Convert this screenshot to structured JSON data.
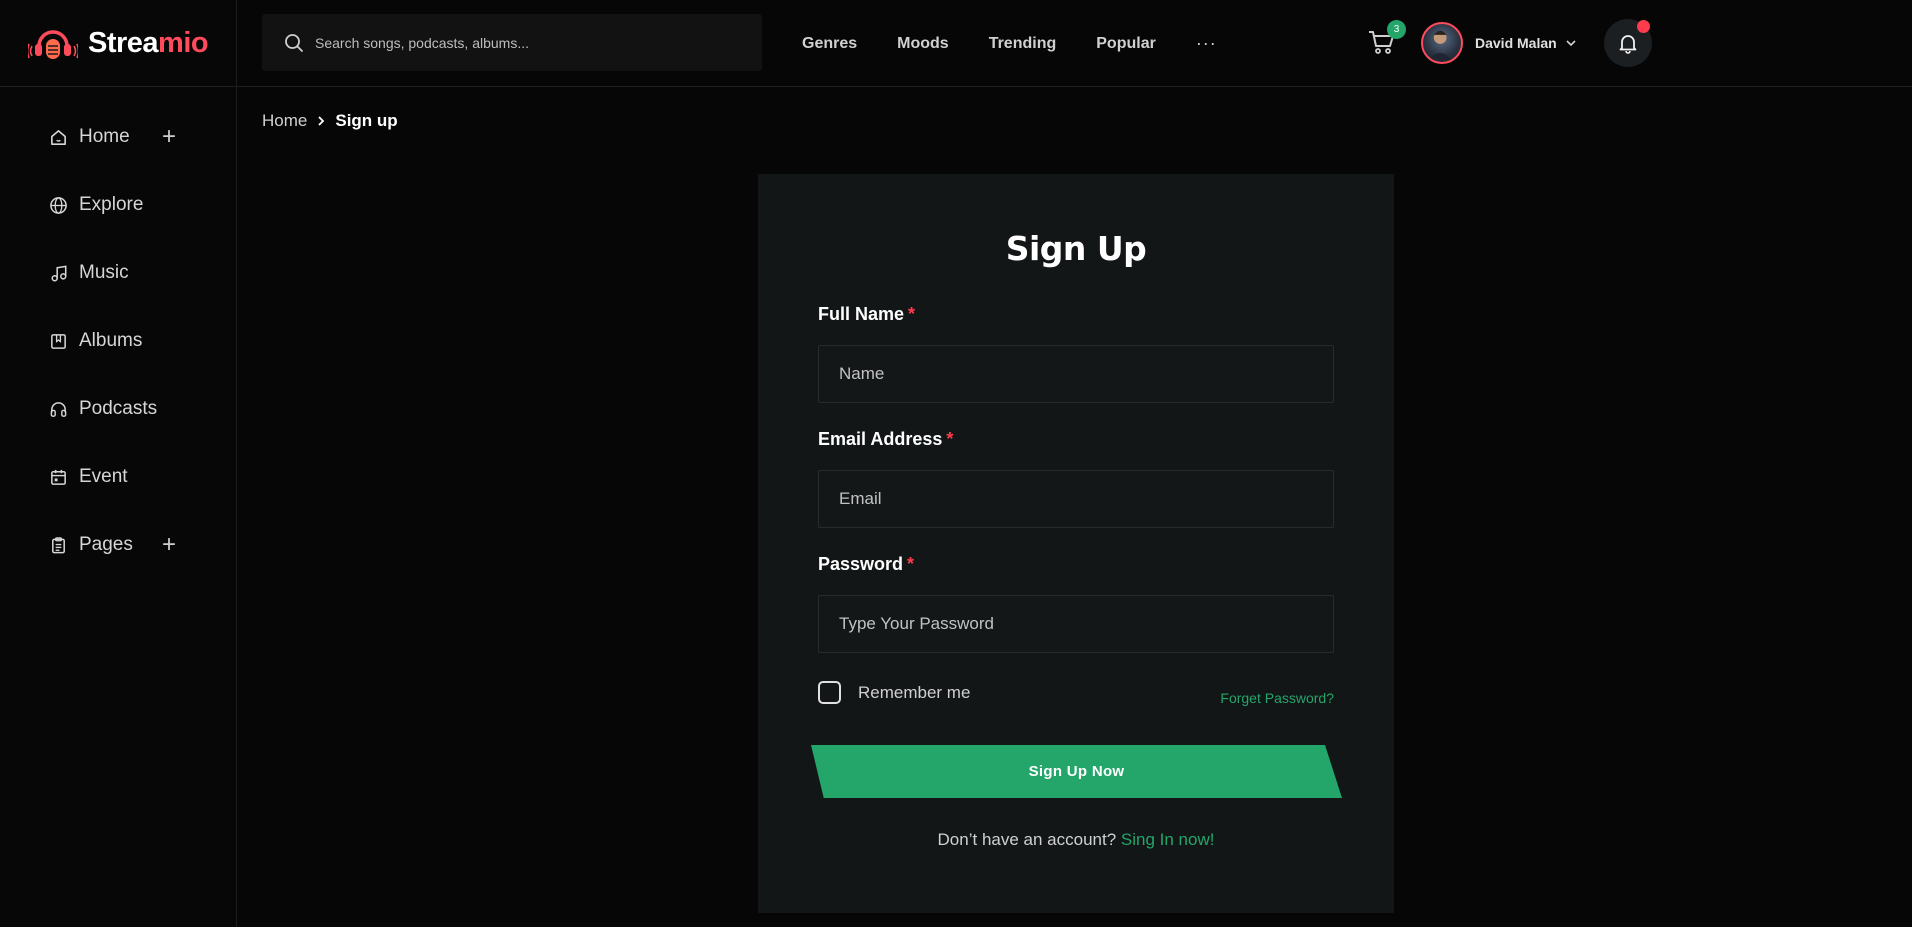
{
  "brand": {
    "name_part1": "Strea",
    "name_part2": "mio",
    "accent_color": "#ff4b5c"
  },
  "sidebar": {
    "items": [
      {
        "label": "Home",
        "icon": "home-icon",
        "expandable": true
      },
      {
        "label": "Explore",
        "icon": "globe-icon",
        "expandable": false
      },
      {
        "label": "Music",
        "icon": "music-note-icon",
        "expandable": false
      },
      {
        "label": "Albums",
        "icon": "album-icon",
        "expandable": false
      },
      {
        "label": "Podcasts",
        "icon": "headphones-icon",
        "expandable": false
      },
      {
        "label": "Event",
        "icon": "calendar-icon",
        "expandable": false
      },
      {
        "label": "Pages",
        "icon": "clipboard-icon",
        "expandable": true
      }
    ],
    "expand_symbol": "+"
  },
  "header": {
    "search_placeholder": "Search songs, podcasts, albums...",
    "nav": [
      "Genres",
      "Moods",
      "Trending",
      "Popular"
    ],
    "more_symbol": "···",
    "cart_count": "3",
    "user_name": "David Malan"
  },
  "breadcrumb": {
    "home": "Home",
    "current": "Sign up"
  },
  "form": {
    "title": "Sign Up",
    "full_name_label": "Full Name",
    "full_name_placeholder": "Name",
    "email_label": "Email Address",
    "email_placeholder": "Email",
    "password_label": "Password",
    "password_placeholder": "Type Your Password",
    "required_mark": "*",
    "remember_label": "Remember me",
    "forgot_label": "Forget Password?",
    "submit_label": "Sign Up Now",
    "signin_prompt": "Don’t have an account?",
    "signin_link": "Sing In now!"
  },
  "colors": {
    "accent_green": "#24a56a",
    "accent_red": "#ff3b4d",
    "card_bg": "#121617"
  }
}
